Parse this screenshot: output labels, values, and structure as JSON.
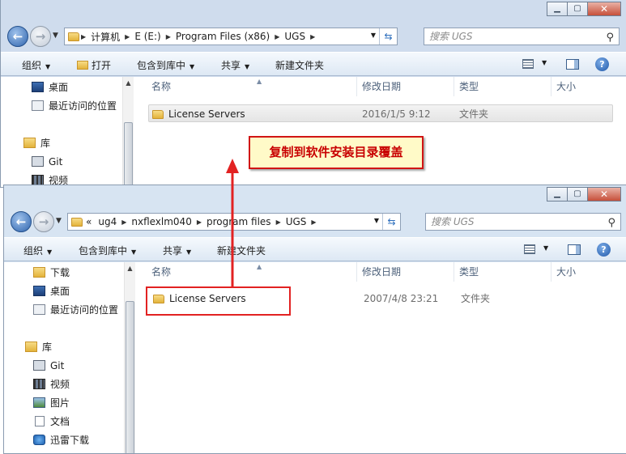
{
  "window_top": {
    "address_crumbs": [
      "计算机",
      "E (E:)",
      "Program Files (x86)",
      "UGS"
    ],
    "search_placeholder": "搜索 UGS",
    "toolbar": {
      "organize": "组织",
      "open": "打开",
      "include_library": "包含到库中",
      "share": "共享",
      "new_folder": "新建文件夹"
    },
    "nav_items": [
      "桌面",
      "最近访问的位置",
      "库",
      "Git",
      "视频"
    ],
    "columns": {
      "name": "名称",
      "modified": "修改日期",
      "type": "类型",
      "size": "大小"
    },
    "files": [
      {
        "name": "License Servers",
        "modified": "2016/1/5 9:12",
        "type": "文件夹",
        "size": ""
      }
    ]
  },
  "window_bottom": {
    "address_crumbs": [
      "ug4",
      "nxflexlm040",
      "program files",
      "UGS"
    ],
    "address_overflow": "«",
    "search_placeholder": "搜索 UGS",
    "toolbar": {
      "organize": "组织",
      "include_library": "包含到库中",
      "share": "共享",
      "new_folder": "新建文件夹"
    },
    "nav_items": [
      "下载",
      "桌面",
      "最近访问的位置",
      "库",
      "Git",
      "视频",
      "图片",
      "文档",
      "迅雷下载"
    ],
    "columns": {
      "name": "名称",
      "modified": "修改日期",
      "type": "类型",
      "size": "大小"
    },
    "files": [
      {
        "name": "License Servers",
        "modified": "2007/4/8 23:21",
        "type": "文件夹",
        "size": ""
      }
    ]
  },
  "annotation": {
    "callout_text": "复制到软件安装目录覆盖",
    "accent_color": "#e22222"
  },
  "icons": [
    "back-arrow-icon",
    "forward-arrow-icon",
    "folder-icon",
    "refresh-icon",
    "search-icon",
    "view-icon",
    "preview-pane-icon",
    "help-icon"
  ]
}
